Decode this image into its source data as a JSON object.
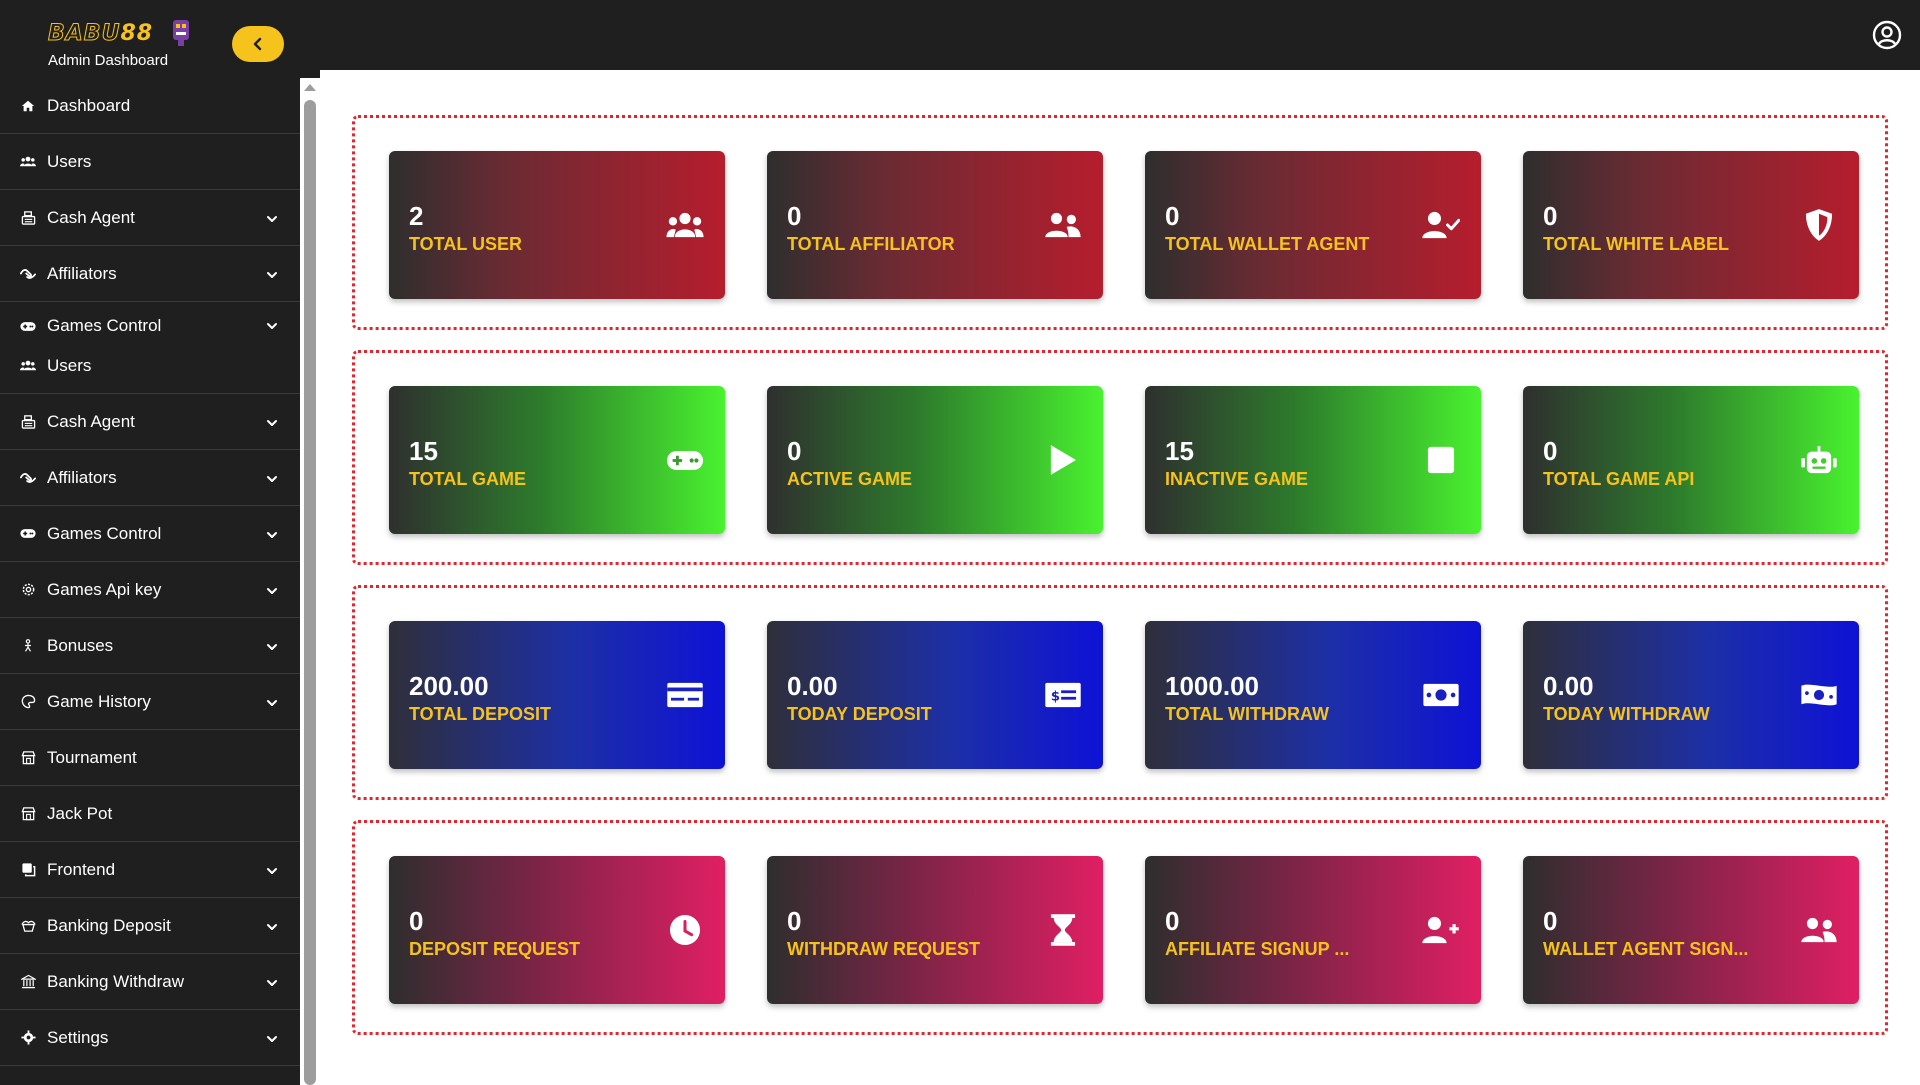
{
  "brand": {
    "logo_text": "BABU88",
    "subtitle": "Admin Dashboard"
  },
  "sidebar": {
    "items": [
      {
        "label": "Dashboard",
        "icon": "home-icon",
        "has_chevron": false
      },
      {
        "label": "Users",
        "icon": "users-icon",
        "has_chevron": false
      },
      {
        "label": "Cash Agent",
        "icon": "cash-register-icon",
        "has_chevron": true
      },
      {
        "label": "Affiliators",
        "icon": "handshake-icon",
        "has_chevron": true
      },
      {
        "label": "Games Control",
        "icon": "gamepad-icon",
        "has_chevron": true
      },
      {
        "label": "Users",
        "icon": "users-icon",
        "has_chevron": false
      },
      {
        "label": "Cash Agent",
        "icon": "cash-register-icon",
        "has_chevron": true
      },
      {
        "label": "Affiliators",
        "icon": "handshake-icon",
        "has_chevron": true
      },
      {
        "label": "Games Control",
        "icon": "gamepad-icon",
        "has_chevron": true
      },
      {
        "label": "Games Api key",
        "icon": "cog-icon",
        "has_chevron": true
      },
      {
        "label": "Bonuses",
        "icon": "person-icon",
        "has_chevron": true
      },
      {
        "label": "Game History",
        "icon": "palette-icon",
        "has_chevron": true
      },
      {
        "label": "Tournament",
        "icon": "store-icon",
        "has_chevron": false
      },
      {
        "label": "Jack Pot",
        "icon": "store-icon",
        "has_chevron": false
      },
      {
        "label": "Frontend",
        "icon": "copy-icon",
        "has_chevron": true
      },
      {
        "label": "Banking Deposit",
        "icon": "gift-icon",
        "has_chevron": true
      },
      {
        "label": "Banking Withdraw",
        "icon": "bank-icon",
        "has_chevron": true
      },
      {
        "label": "Settings",
        "icon": "gear-icon",
        "has_chevron": true
      }
    ]
  },
  "groups": [
    {
      "theme": "red",
      "cards": [
        {
          "value": "2",
          "label": "TOTAL USER",
          "icon": "users-icon"
        },
        {
          "value": "0",
          "label": "TOTAL AFFILIATOR",
          "icon": "user-friends-icon"
        },
        {
          "value": "0",
          "label": "TOTAL WALLET AGENT",
          "icon": "user-check-icon"
        },
        {
          "value": "0",
          "label": "TOTAL WHITE LABEL",
          "icon": "shield-icon"
        }
      ]
    },
    {
      "theme": "green",
      "cards": [
        {
          "value": "15",
          "label": "TOTAL GAME",
          "icon": "gamepad-icon"
        },
        {
          "value": "0",
          "label": "ACTIVE GAME",
          "icon": "play-icon"
        },
        {
          "value": "15",
          "label": "INACTIVE GAME",
          "icon": "stop-icon"
        },
        {
          "value": "0",
          "label": "TOTAL GAME API",
          "icon": "robot-icon"
        }
      ]
    },
    {
      "theme": "blue",
      "cards": [
        {
          "value": "200.00",
          "label": "TOTAL DEPOSIT",
          "icon": "credit-card-icon"
        },
        {
          "value": "0.00",
          "label": "TODAY DEPOSIT",
          "icon": "money-check-icon"
        },
        {
          "value": "1000.00",
          "label": "TOTAL WITHDRAW",
          "icon": "money-bill-icon"
        },
        {
          "value": "0.00",
          "label": "TODAY WITHDRAW",
          "icon": "money-bill-wave-icon"
        }
      ]
    },
    {
      "theme": "pink",
      "cards": [
        {
          "value": "0",
          "label": "DEPOSIT REQUEST",
          "icon": "clock-icon"
        },
        {
          "value": "0",
          "label": "WITHDRAW REQUEST",
          "icon": "hourglass-icon"
        },
        {
          "value": "0",
          "label": "AFFILIATE SIGNUP ...",
          "icon": "user-plus-icon"
        },
        {
          "value": "0",
          "label": "WALLET AGENT SIGN...",
          "icon": "user-friends-icon"
        }
      ]
    }
  ],
  "colors": {
    "accent": "#f6c21c",
    "sidebar_bg": "#1f1f1f",
    "group_border": "#e0262f"
  }
}
